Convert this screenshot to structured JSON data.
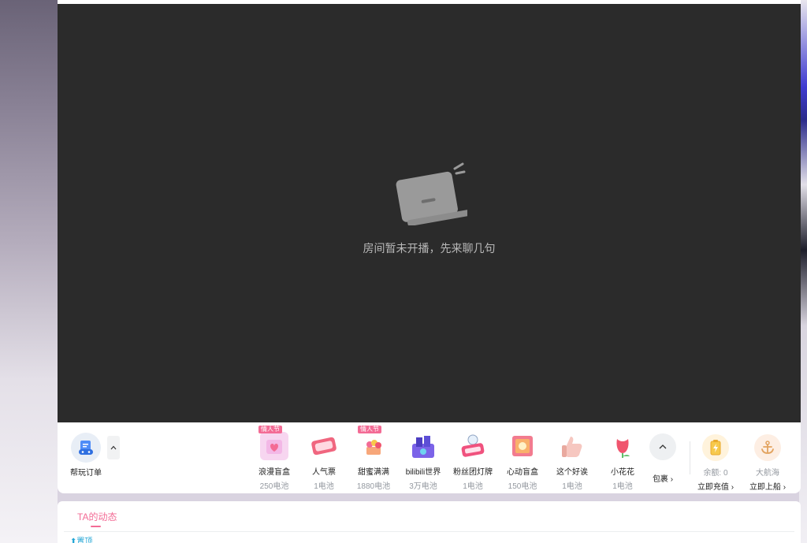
{
  "player": {
    "offline_text": "房间暂未开播，先来聊几句"
  },
  "gift_bar": {
    "order": {
      "label": "帮玩订单"
    },
    "gifts": [
      {
        "tag": "情人节",
        "name": "浪漫盲盒",
        "price": "250电池",
        "color": "#f3b8e6"
      },
      {
        "tag": "",
        "name": "人气票",
        "price": "1电池",
        "color": "#f0667f"
      },
      {
        "tag": "情人节",
        "name": "甜蜜满满",
        "price": "1880电池",
        "color": "#f7a77a"
      },
      {
        "tag": "",
        "name": "bilibili世界",
        "price": "3万电池",
        "color": "#7b63e8"
      },
      {
        "tag": "",
        "name": "粉丝团灯牌",
        "price": "1电池",
        "color": "#f0527e"
      },
      {
        "tag": "",
        "name": "心动盲盒",
        "price": "150电池",
        "color": "#f27b8f"
      },
      {
        "tag": "",
        "name": "这个好诶",
        "price": "1电池",
        "color": "#f6c7c0"
      },
      {
        "tag": "",
        "name": "小花花",
        "price": "1电池",
        "color": "#f0556e"
      }
    ],
    "more_label": "包裹",
    "recharge": {
      "sub": "余额: 0",
      "action": "立即充值"
    },
    "guard": {
      "sub": "大航海",
      "action": "立即上船"
    }
  },
  "dynamic": {
    "tab_label": "TA的动态",
    "pin_label": "置顶"
  },
  "colors": {
    "accent_pink": "#f36b95",
    "player_bg": "#2b2b2b",
    "link_blue": "#23a6d5"
  }
}
